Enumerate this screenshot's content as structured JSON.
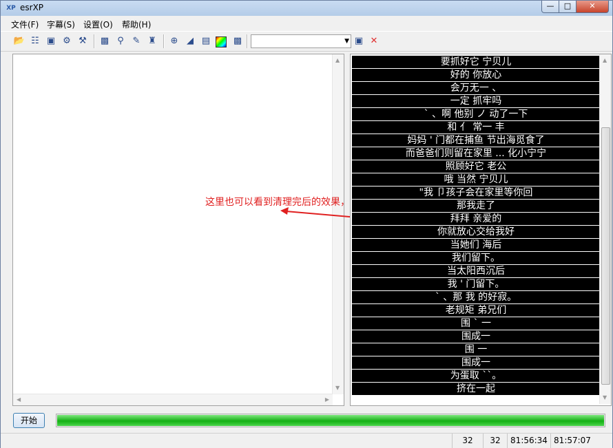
{
  "window": {
    "title": "esrXP",
    "app_icon": "XP"
  },
  "menu": [
    "文件(F)",
    "字幕(S)",
    "设置(O)",
    "帮助(H)"
  ],
  "toolbar": {
    "combo_value": "",
    "icons": [
      "open-folder-icon",
      "import-icon",
      "save-icon",
      "settings-icon",
      "tools-icon",
      "film-icon",
      "search-icon",
      "edit-icon",
      "clean-icon",
      "zoom-in-icon",
      "stairs-icon",
      "document-icon",
      "color-icon",
      "export-icon",
      "save-sub-icon",
      "delete-icon"
    ]
  },
  "annotation": "这里也可以看到清理完后的效果，全是有效行",
  "annotation_color": "#e02020",
  "subtitles": [
    "要抓好它 宁贝儿",
    "好的 你放心",
    "会万无一 、",
    "一定  抓牢吗",
    "` 、啊 他别 ノ 动了一下",
    "和 亻 常一 丰",
    "妈妈 ' 门都在捕鱼  节出海觅食了",
    "而爸爸们则留在家里 ... 化小宁宁",
    "照顾好它 老公",
    "哦 当然 宁贝儿",
    "\"我 卩孩子会在家里等你回",
    "那我走了",
    "拜拜 亲爱的",
    "你就放心交给我好",
    "当她们  海后",
    "我们留下。",
    "当太阳西沉后",
    "我 ' 门留下。",
    "` 、那 我  的好寂。",
    "老规矩 弟兄们",
    "围 ` 一",
    "围成一",
    "围  一",
    "围成一",
    "为蛋取 ``。",
    "挤在一起"
  ],
  "controls": {
    "start_label": "开始",
    "progress_percent": 100,
    "progress_color": "#14b014"
  },
  "status": [
    "32",
    "32",
    "81:56:34",
    "81:57:07"
  ]
}
